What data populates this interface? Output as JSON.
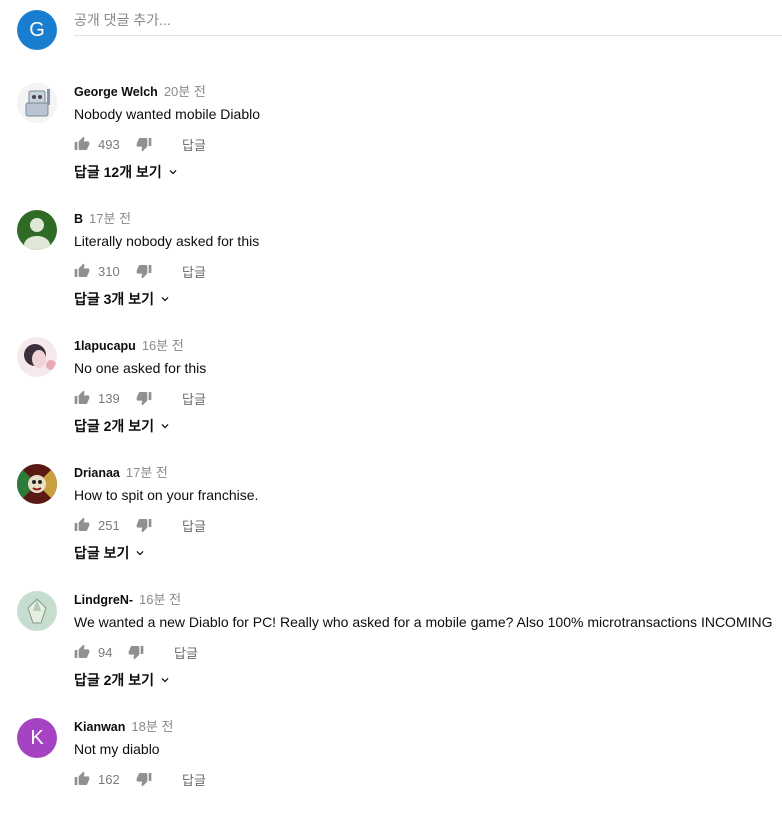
{
  "compose": {
    "avatar_letter": "G",
    "avatar_color": "#1a7ed0",
    "placeholder": "공개 댓글 추가..."
  },
  "comments": [
    {
      "author": "George Welch",
      "time": "20분 전",
      "text": "Nobody wanted mobile Diablo",
      "likes": "493",
      "reply_label": "답글",
      "view_replies": "답글 12개 보기",
      "avatar": "robot-avatar"
    },
    {
      "author": "B",
      "time": "17분 전",
      "text": "Literally nobody asked for this",
      "likes": "310",
      "reply_label": "답글",
      "view_replies": "답글 3개 보기",
      "avatar": "default-avatar"
    },
    {
      "author": "1lapucapu",
      "time": "16분 전",
      "text": "No one asked for this",
      "likes": "139",
      "reply_label": "답글",
      "view_replies": "답글 2개 보기",
      "avatar": "portrait-avatar"
    },
    {
      "author": "Drianaa",
      "time": "17분 전",
      "text": "How to spit on your franchise.",
      "likes": "251",
      "reply_label": "답글",
      "view_replies": "답글 보기",
      "avatar": "art-avatar"
    },
    {
      "author": "LindgreN-",
      "time": "16분 전",
      "text": "We wanted a new Diablo for PC! Really who asked for a mobile game? Also 100% microtransactions INCOMING",
      "likes": "94",
      "reply_label": "답글",
      "view_replies": "답글 2개 보기",
      "avatar": "gem-avatar"
    },
    {
      "author": "Kianwan",
      "time": "18분 전",
      "text": "Not my diablo",
      "likes": "162",
      "reply_label": "답글",
      "avatar_letter": "K",
      "avatar_color": "#a543c3",
      "avatar": "letter-avatar"
    }
  ]
}
